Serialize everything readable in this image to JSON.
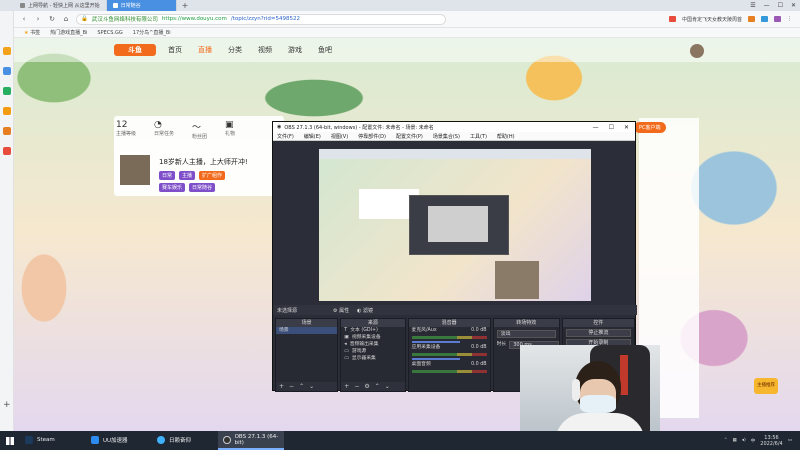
{
  "browser": {
    "tabs": [
      {
        "label": "上网导航 - 轻快上网 从这里开始",
        "active": false
      },
      {
        "label": "日常随谷",
        "active": true
      }
    ],
    "address": {
      "secure_label": "武汉斗鱼网络科技有限公司",
      "host": "https://www.douyu.com",
      "path": "/topic/zzyn?rid=5498522"
    },
    "search_hint": "中国肯定飞天女教天陵周首",
    "bookmarks": [
      "书签",
      "热门游戏直播_Bi",
      "SPECS.GG",
      "17分鸟^直播_Bi"
    ]
  },
  "douyu": {
    "nav": [
      "首页",
      "直播",
      "分类",
      "视频",
      "游戏",
      "鱼吧"
    ],
    "active_nav": "直播",
    "logo": "斗鱼",
    "stats": [
      {
        "num": "12",
        "label": "主播等级"
      },
      {
        "num": "",
        "label": "日常任务"
      },
      {
        "num": "",
        "label": "粉丝团"
      },
      {
        "num": "",
        "label": "礼物"
      }
    ],
    "room_title": "18岁新人主播，上大师开冲!",
    "tags": [
      "日常",
      "主播",
      "扩广组作"
    ],
    "actions": [
      "赛车娱乐",
      "日常随谷"
    ],
    "pc_client": "PC客户端",
    "badge": "主播推荐"
  },
  "obs": {
    "title": "OBS 27.1.3 (64-bit, windows) - 配置文件: 未命名 - 场景: 未命名",
    "menu": [
      "文件(F)",
      "编辑(E)",
      "视图(V)",
      "停靠部件(D)",
      "配置文件(P)",
      "场景集合(S)",
      "工具(T)",
      "帮助(H)"
    ],
    "no_source": "未选择源",
    "ctrl_buttons": [
      "属性",
      "滤镜"
    ],
    "docks": {
      "scenes": {
        "title": "场景",
        "items": [
          "场景"
        ]
      },
      "sources": {
        "title": "来源",
        "items": [
          "文本 (GDI+)",
          "视频采集设备",
          "音频输出采集",
          "游戏源",
          "显示器采集"
        ]
      },
      "mixer": {
        "title": "混音器",
        "channels": [
          "麦克风/Aux",
          "应用采集设备",
          "桌面音频"
        ],
        "level": "0.0 dB"
      },
      "transitions": {
        "title": "转场特效",
        "type": "淡出",
        "duration_label": "时长",
        "duration": "300 ms"
      },
      "controls": {
        "title": "控件",
        "buttons": [
          "停止推流",
          "开始录制",
          "启动虚拟摄像机",
          "工作室模式",
          "设置",
          "退出"
        ]
      }
    },
    "status": "LIVE: 00:00:00  REC: 00:00:00  CPU: 1.2%, 30.00 fps"
  },
  "taskbar": {
    "items": [
      {
        "label": "Steam",
        "active": false,
        "color": "#1b3a5c"
      },
      {
        "label": "UU加速器",
        "active": false,
        "color": "#2d8cf0"
      },
      {
        "label": "日赖奋仰",
        "active": false,
        "color": "#3fb2ff"
      },
      {
        "label": "OBS 27.1.3 (64-bit)",
        "active": true,
        "color": "#333333"
      }
    ],
    "time": "13:56",
    "date": "2022/6/4"
  }
}
